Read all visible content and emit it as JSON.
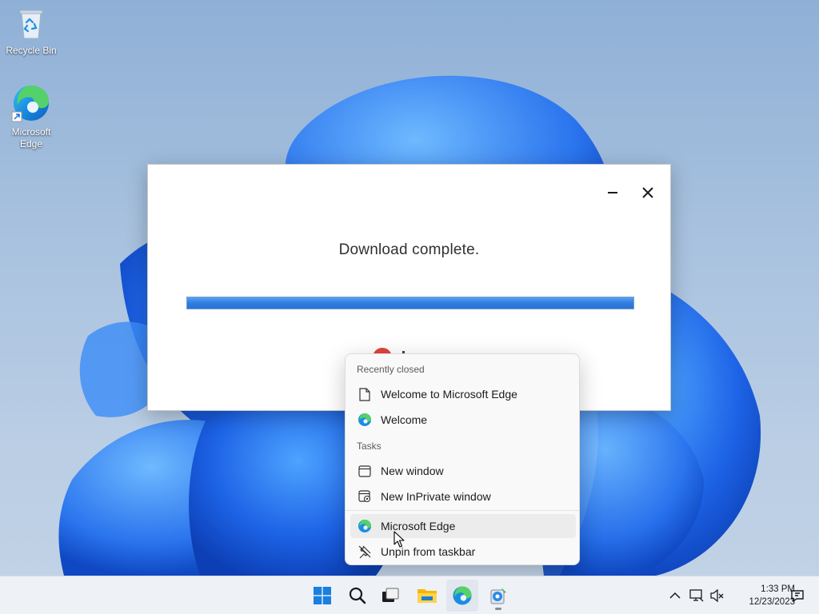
{
  "desktop": {
    "icons": [
      {
        "label": "Recycle Bin",
        "icon": "recycle-bin-icon"
      },
      {
        "label": "Microsoft Edge",
        "icon": "edge-icon"
      }
    ]
  },
  "dialog": {
    "title": "Download complete.",
    "progress_fraction": 1.0,
    "minimize_icon": "minimize-icon",
    "close_icon": "close-icon"
  },
  "jumplist": {
    "recently_closed_header": "Recently closed",
    "recently_closed": [
      {
        "label": "Welcome to Microsoft Edge",
        "icon": "document-icon"
      },
      {
        "label": "Welcome",
        "icon": "edge-icon"
      }
    ],
    "tasks_header": "Tasks",
    "tasks": [
      {
        "label": "New window",
        "icon": "window-icon"
      },
      {
        "label": "New InPrivate window",
        "icon": "inprivate-window-icon"
      }
    ],
    "app_item": {
      "label": "Microsoft Edge",
      "icon": "edge-icon"
    },
    "unpin_item": {
      "label": "Unpin from taskbar",
      "icon": "unpin-icon"
    }
  },
  "taskbar": {
    "buttons": [
      "start-icon",
      "search-icon",
      "task-view-icon",
      "file-explorer-icon",
      "edge-icon",
      "installer-icon"
    ],
    "clock": {
      "time": "1:33 PM",
      "date": "12/23/2023"
    },
    "tray_icons": [
      "chevron-up-icon",
      "network-icon",
      "volume-muted-icon",
      "notification-icon"
    ]
  },
  "colors": {
    "accent": "#2f7ee0",
    "wallpaper_bloom": "#1a5fe0"
  }
}
